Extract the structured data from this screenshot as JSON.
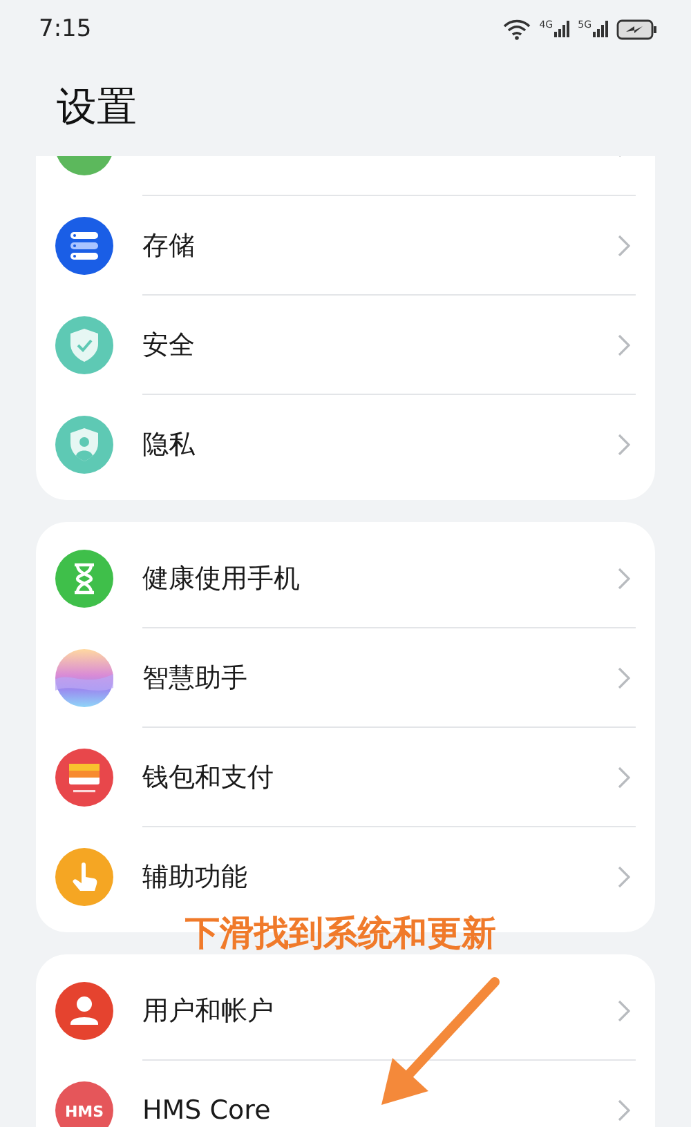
{
  "status_bar": {
    "time": "7:15",
    "network_1": "4G",
    "network_2": "5G"
  },
  "title": "设置",
  "groups": [
    {
      "items": [
        {
          "kind": "battery"
        },
        {
          "label": "存储",
          "kind": "storage"
        },
        {
          "label": "安全",
          "kind": "security"
        },
        {
          "label": "隐私",
          "kind": "privacy"
        }
      ]
    },
    {
      "items": [
        {
          "label": "健康使用手机",
          "kind": "hourglass"
        },
        {
          "label": "智慧助手",
          "kind": "assistant"
        },
        {
          "label": "钱包和支付",
          "kind": "wallet"
        },
        {
          "label": "辅助功能",
          "kind": "hand"
        }
      ]
    },
    {
      "items": [
        {
          "label": "用户和帐户",
          "kind": "user"
        },
        {
          "label": "HMS Core",
          "kind": "hms",
          "icon_text": "HMS"
        }
      ]
    }
  ],
  "annotation": {
    "text": "下滑找到系统和更新"
  }
}
